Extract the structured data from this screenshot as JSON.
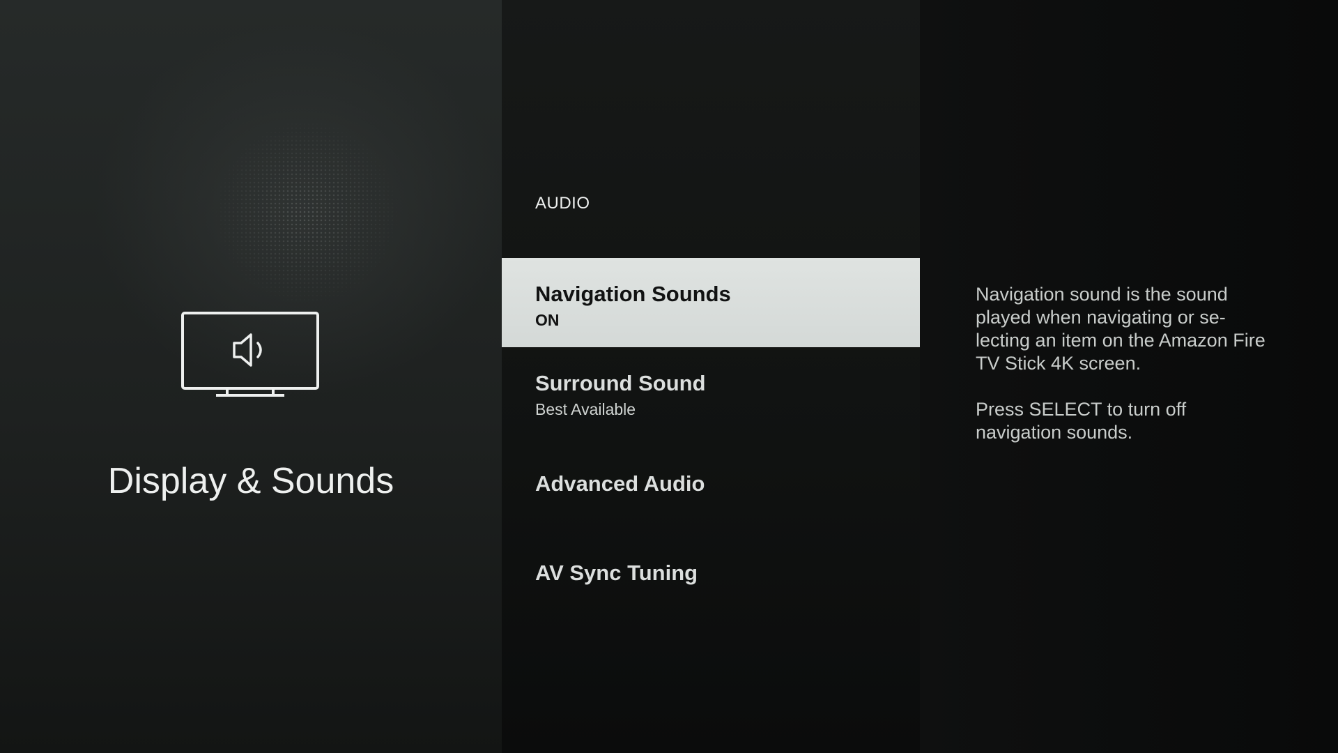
{
  "category": {
    "title": "Display & Sounds",
    "icon": "tv-speaker-icon"
  },
  "section": {
    "label": "AUDIO"
  },
  "menu": {
    "items": [
      {
        "title": "Navigation Sounds",
        "subtitle": "ON",
        "selected": true
      },
      {
        "title": "Surround Sound",
        "subtitle": "Best Available",
        "selected": false
      },
      {
        "title": "Advanced Audio",
        "subtitle": "",
        "selected": false
      },
      {
        "title": "AV Sync Tuning",
        "subtitle": "",
        "selected": false
      }
    ]
  },
  "description": {
    "line1": "Navigation sound is the sound played when navigating or se-lecting an item on the Amazon Fire TV Stick 4K screen.",
    "line2": "Press SELECT to turn off navigation sounds."
  },
  "colors": {
    "highlight": "#dfe3e1",
    "text": "#eef0ef",
    "background": "#0b0c0c"
  }
}
